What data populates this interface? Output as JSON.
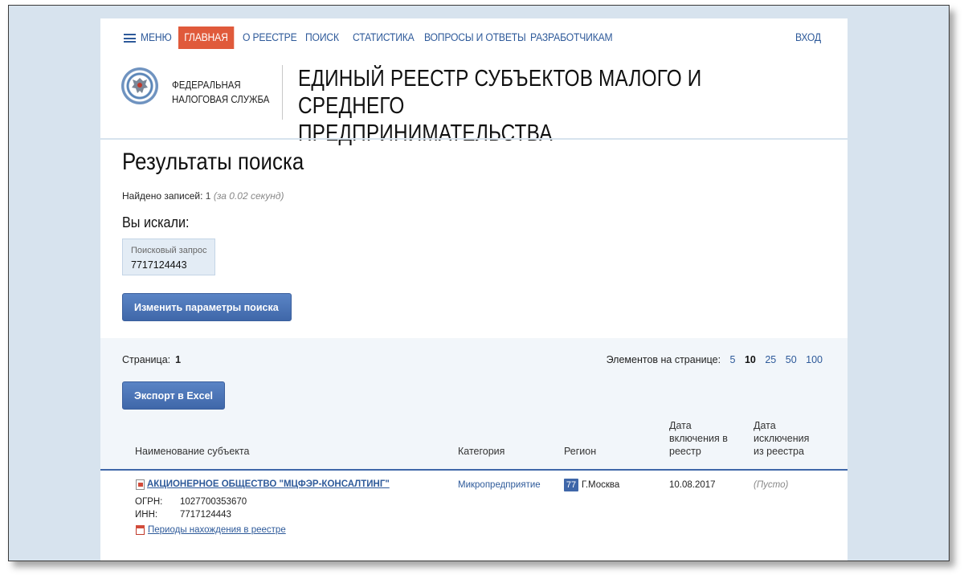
{
  "nav": {
    "menu_label": "МЕНЮ",
    "items": [
      {
        "label": "ГЛАВНАЯ"
      },
      {
        "label": "О РЕЕСТРЕ"
      },
      {
        "label": "ПОИСК"
      },
      {
        "label": "СТАТИСТИКА"
      },
      {
        "label": "ВОПРОСЫ И ОТВЕТЫ"
      },
      {
        "label": "РАЗРАБОТЧИКАМ"
      }
    ],
    "login_label": "ВХОД",
    "active_color": "#e05a3b",
    "link_color": "#2e5a9a"
  },
  "header": {
    "org_line1": "ФЕДЕРАЛЬНАЯ",
    "org_line2": "НАЛОГОВАЯ СЛУЖБА",
    "title_line1": "ЕДИНЫЙ РЕЕСТР СУБЪЕКТОВ МАЛОГО И СРЕДНЕГО",
    "title_line2": "ПРЕДПРИНИМАТЕЛЬСТВА",
    "emblem_icon": "fns-emblem-icon"
  },
  "results": {
    "title": "Результаты поиска",
    "found_label": "Найдено записей:",
    "found_count": "1",
    "found_time": "(за 0.02 секунд)",
    "searched_label": "Вы искали:",
    "query_label": "Поисковый запрос",
    "query_value": "7717124443",
    "change_button": "Изменить параметры поиска"
  },
  "pagination": {
    "page_label": "Страница:",
    "page_number": "1",
    "per_page_label": "Элементов на странице:",
    "per_page_options": [
      "5",
      "10",
      "25",
      "50",
      "100"
    ],
    "per_page_selected": "10"
  },
  "export_button": "Экспорт в Excel",
  "table": {
    "headers": {
      "name": "Наименование субъекта",
      "category": "Категория",
      "region": "Регион",
      "included": "Дата включения в реестр",
      "excluded": "Дата исключения из реестра"
    },
    "rows": [
      {
        "name": "АКЦИОНЕРНОЕ ОБЩЕСТВО \"МЦФЭР-КОНСАЛТИНГ\"",
        "ogrn_label": "ОГРН:",
        "ogrn": "1027700353670",
        "inn_label": "ИНН:",
        "inn": "7717124443",
        "periods_link": "Периоды нахождения в реестре",
        "category": "Микропредприятие",
        "region_code": "77",
        "region_name": "Г.Москва",
        "included": "10.08.2017",
        "excluded": "(Пусто)"
      }
    ]
  }
}
